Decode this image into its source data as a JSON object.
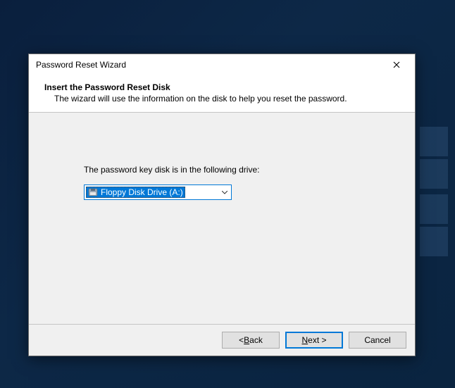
{
  "window": {
    "title": "Password Reset Wizard"
  },
  "header": {
    "title": "Insert the Password Reset Disk",
    "subtitle": "The wizard will use the information on the disk to help you reset the password."
  },
  "body": {
    "prompt": "The password key disk is in the following drive:",
    "drive_select": {
      "icon": "floppy-icon",
      "selected": "Floppy Disk Drive (A:)"
    }
  },
  "buttons": {
    "back_prefix": "< ",
    "back_u": "B",
    "back_rest": "ack",
    "next_u": "N",
    "next_rest": "ext >",
    "cancel": "Cancel"
  }
}
